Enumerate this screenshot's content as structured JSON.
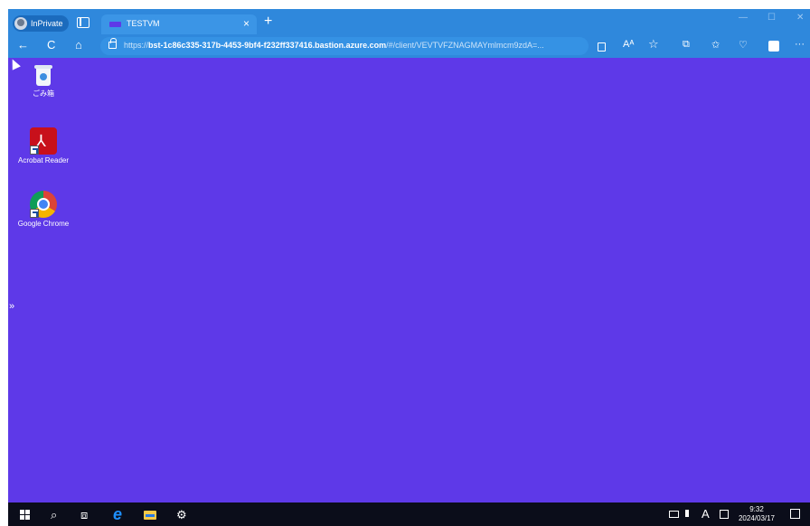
{
  "browser": {
    "profile_label": "InPrivate",
    "tab": {
      "title": "TESTVM",
      "close": "×"
    },
    "new_tab": "+",
    "window_controls": {
      "minimize": "—",
      "maximize": "☐",
      "close": "✕"
    },
    "nav": {
      "back": "←",
      "refresh": "C",
      "home": "⌂"
    },
    "url": {
      "scheme": "https://",
      "host": "bst-1c86c335-317b-4453-9bf4-f232ff337416.bastion.azure.com",
      "path": "/#/client/VEVTVFZNAGMAYmlmcm9zdA=..."
    },
    "toolbar": {
      "read_aloud": "Aᴬ",
      "favorite": "☆",
      "split": "⧉",
      "favorites": "✩",
      "health": "♡",
      "more": "···"
    }
  },
  "desktop": {
    "icons": [
      {
        "label": "ごみ箱",
        "icon": "recycle-bin-icon"
      },
      {
        "label": "Acrobat Reader",
        "icon": "acrobat-reader-icon"
      },
      {
        "label": "Google Chrome",
        "icon": "google-chrome-icon"
      }
    ],
    "side_handle": "»",
    "background_color": "#5e39e8"
  },
  "taskbar": {
    "search": "⌕",
    "task_view": "⧈",
    "settings": "⚙",
    "tray_ime": "A",
    "clock": {
      "time": "9:32",
      "date": "2024/03/17"
    }
  }
}
